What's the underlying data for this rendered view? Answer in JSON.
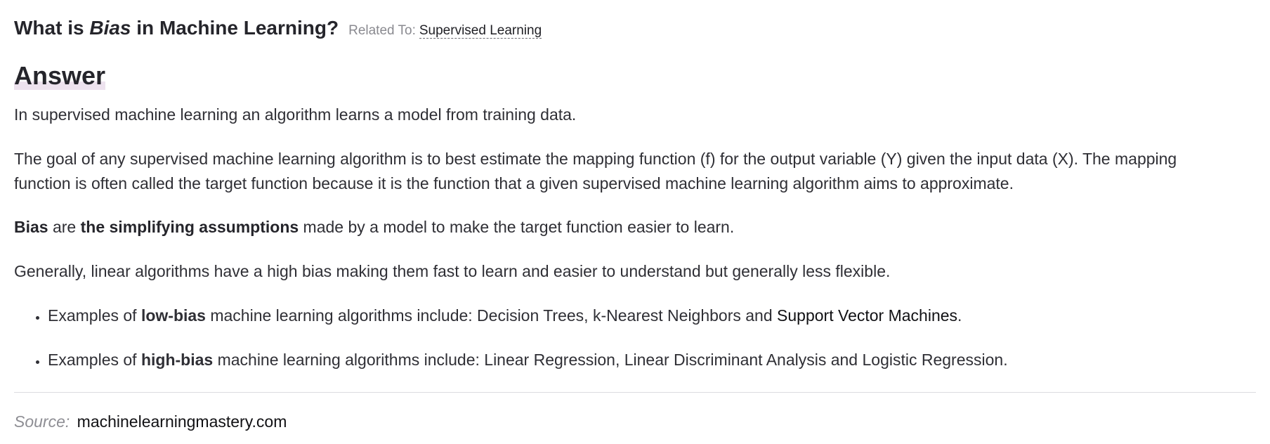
{
  "question": {
    "prefix": "What is",
    "term": "Bias",
    "suffix": "in Machine Learning?",
    "related_label": "Related To:",
    "related_link": "Supervised Learning"
  },
  "answer": {
    "heading": "Answer",
    "paragraph_1": "In supervised machine learning an algorithm learns a model from training data.",
    "paragraph_2": "The goal of any supervised machine learning algorithm is to best estimate the mapping function (f) for the output variable (Y) given the input data (X). The mapping function is often called the target function because it is the function that a given supervised machine learning algorithm aims to approximate.",
    "paragraph_3": {
      "bold_1": "Bias",
      "text_1": " are ",
      "bold_2": "the simplifying assumptions",
      "text_2": " made by a model to make the target function easier to learn."
    },
    "paragraph_4": "Generally, linear algorithms have a high bias making them fast to learn and easier to understand but generally less flexible.",
    "bullets": [
      {
        "text_1": "Examples of ",
        "bold": "low-bias",
        "text_2": " machine learning algorithms include: Decision Trees, k-Nearest Neighbors and ",
        "link": "Support Vector Machines",
        "text_3": "."
      },
      {
        "text_1": "Examples of ",
        "bold": "high-bias",
        "text_2": " machine learning algorithms include: Linear Regression, Linear Discriminant Analysis and Logistic Regression."
      }
    ]
  },
  "source": {
    "label": "Source:",
    "link": "machinelearningmastery.com"
  }
}
